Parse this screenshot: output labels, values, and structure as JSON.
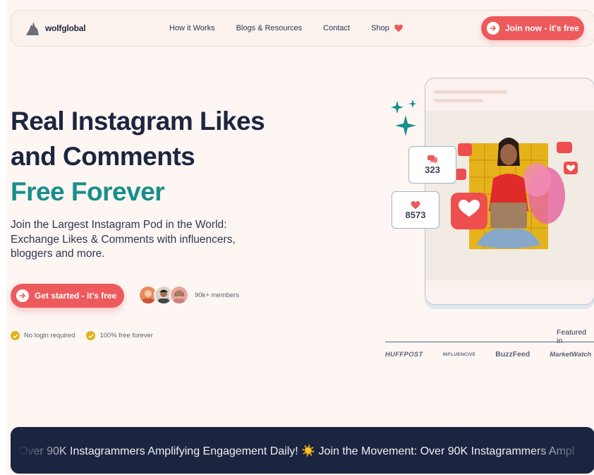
{
  "brand": {
    "name": "wolfglobal"
  },
  "nav": {
    "links": [
      "How it Works",
      "Blogs & Resources",
      "Contact",
      "Shop"
    ],
    "cta_label": "Join now - it's free"
  },
  "hero": {
    "title_line1": "Real Instagram Likes",
    "title_line2": "and Comments",
    "title_accent": "Free Forever",
    "subtitle": "Join the Largest Instagram Pod in the World: Exchange Likes & Comments with influencers, bloggers and more.",
    "cta_label": "Get started - it's free",
    "members": "90k+ members",
    "checks": [
      "No login required",
      "100% free forever"
    ]
  },
  "stats": {
    "comments": "323",
    "likes": "8573"
  },
  "featured": {
    "label": "Featured in",
    "logos": [
      "HUFFPOST",
      "INFLUENCIVE",
      "BuzzFeed",
      "MarketWatch"
    ]
  },
  "banner": {
    "text": "Over 90K Instagrammers Amplifying Engagement Daily! ☀️  Join the Movement: Over 90K Instagrammers Ampl"
  },
  "colors": {
    "accent": "#ed5a5d",
    "teal": "#168f8b",
    "navy": "#1c2540",
    "gold": "#e3b21c"
  },
  "icons": [
    "wolf-logo-icon",
    "heart-icon",
    "arrow-right-icon",
    "check-icon",
    "comment-icon",
    "sparkle-icon"
  ]
}
